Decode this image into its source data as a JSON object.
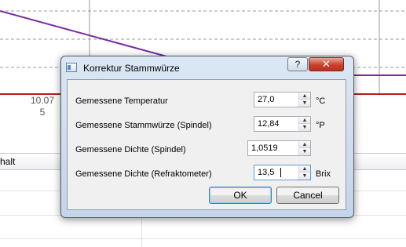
{
  "background": {
    "date_line1": "10.07",
    "date_line2": "5",
    "table_header": "halt",
    "colors": {
      "series_purple": "#7a2aa0",
      "series_red": "#b41e1e"
    }
  },
  "dialog": {
    "title": "Korrektur Stammwürze",
    "help_label": "?",
    "close_label": "✕",
    "rows": [
      {
        "label": "Gemessene Temperatur",
        "value": "27,0",
        "unit": "°C"
      },
      {
        "label": "Gemessene Stammwürze (Spindel)",
        "value": "12,84",
        "unit": "°P"
      },
      {
        "label": "Gemessene Dichte (Spindel)",
        "value": "1,0519",
        "unit": ""
      },
      {
        "label": "Gemessene Dichte (Refraktometer)",
        "value": "13,5",
        "unit": "Brix"
      }
    ],
    "ok_label": "OK",
    "cancel_label": "Cancel"
  }
}
